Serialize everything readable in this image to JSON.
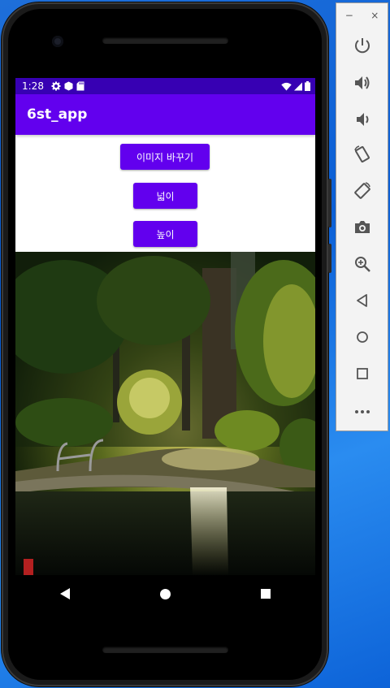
{
  "status_bar": {
    "time": "1:28"
  },
  "app_bar": {
    "title": "6st_app"
  },
  "buttons": {
    "change_image": "이미지 바꾸기",
    "width": "넓이",
    "height": "높이"
  },
  "emulator_panel": {
    "minimize": "−",
    "close": "×",
    "tools": [
      "power-icon",
      "volume-up-icon",
      "volume-down-icon",
      "rotate-left-icon",
      "rotate-right-icon",
      "camera-icon",
      "zoom-icon",
      "back-icon",
      "home-icon",
      "overview-icon",
      "more-icon"
    ]
  },
  "colors": {
    "status_bar": "#3700b3",
    "app_bar": "#6200ee",
    "button": "#6200ee",
    "desktop": "#0b5fd6"
  }
}
